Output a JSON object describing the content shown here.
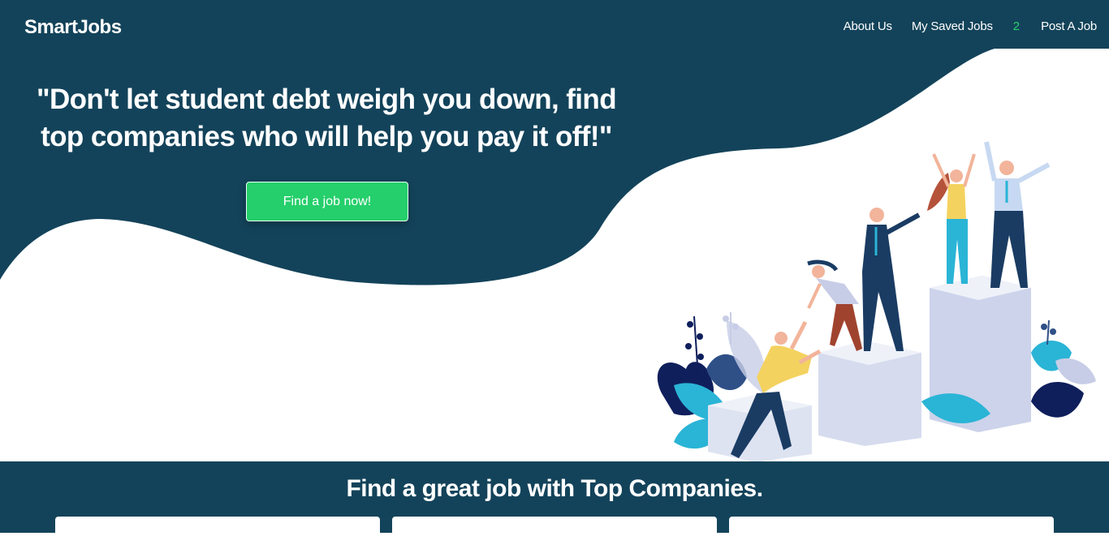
{
  "nav": {
    "brand": "SmartJobs",
    "about_label": "About Us",
    "saved_label": "My Saved Jobs",
    "saved_count": "2",
    "post_label": "Post A Job"
  },
  "hero": {
    "quote": "\"Don't let student debt weigh you down, find top companies who will help you pay it off!\"",
    "cta_label": "Find a job now!"
  },
  "companies_section": {
    "title": "Find a great job with Top Companies."
  },
  "colors": {
    "primary_dark": "#13435a",
    "accent_green": "#25cf6b",
    "background": "#ffffff"
  }
}
